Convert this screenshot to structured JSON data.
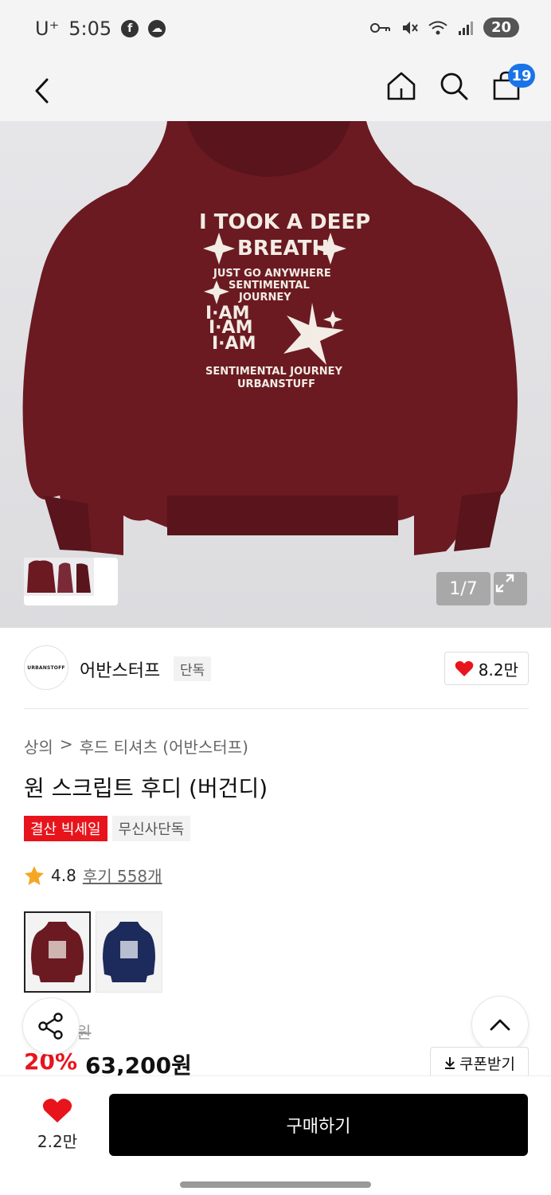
{
  "status_bar": {
    "carrier": "U⁺",
    "time": "5:05",
    "battery": "20"
  },
  "nav": {
    "cart_count": "19"
  },
  "hero": {
    "counter": "1/7",
    "print_lines": [
      "I TOOK A DEEP",
      "BREATH",
      "JUST GO ANYWHERE",
      "SENTIMENTAL",
      "JOURNEY",
      "I·AM",
      "I·AM",
      "I·AM",
      "SENTIMENTAL JOURNEY",
      "URBANSTUFF"
    ]
  },
  "brand": {
    "logo_text": "URBANSTOFF",
    "name": "어반스터프",
    "tag": "단독",
    "likes": "8.2만"
  },
  "breadcrumb": {
    "category": "상의",
    "separator": ">",
    "subcategory": "후드 티셔츠 (어반스터프)"
  },
  "product": {
    "title": "원 스크립트 후디 (버건디)",
    "badge_sale": "결산 빅세일",
    "badge_exclusive": "무신사단독",
    "rating": "4.8",
    "reviews": "후기 558개",
    "original_price_fragment": "원",
    "discount": "20%",
    "price": "63,200원",
    "coupon_label": "쿠폰받기"
  },
  "bottom": {
    "likes": "2.2만",
    "buy_label": "구매하기"
  },
  "colors": {
    "burgundy": "#6b1a22",
    "navy": "#1d2a5c",
    "sale_red": "#e8141c",
    "badge_blue": "#1a73e8"
  }
}
